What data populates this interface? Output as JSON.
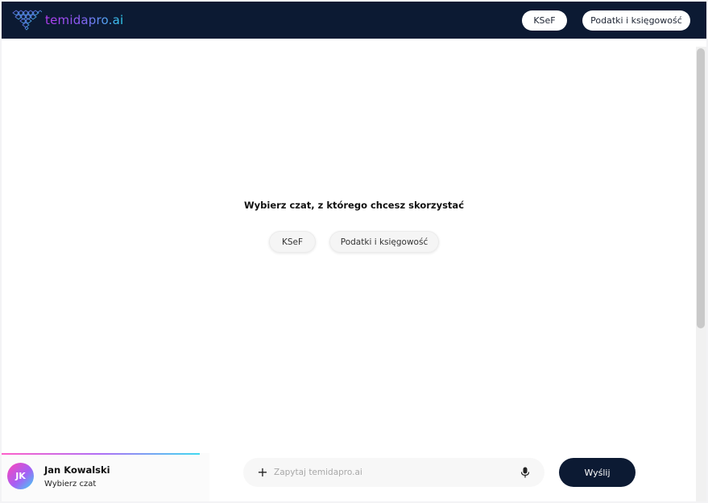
{
  "app": {
    "logo_text": "temidapro.ai"
  },
  "header": {
    "buttons": [
      {
        "label": "KSeF"
      },
      {
        "label": "Podatki i księgowość"
      }
    ]
  },
  "main": {
    "title": "Wybierz czat, z którego chcesz skorzystać",
    "chips": [
      {
        "label": "KSeF"
      },
      {
        "label": "Podatki i księgowość"
      }
    ]
  },
  "user": {
    "initials": "JK",
    "name": "Jan Kowalski",
    "subtitle": "Wybierz czat"
  },
  "composer": {
    "plus_icon": "plus-icon",
    "placeholder": "Zapytaj temidapro.ai",
    "value": "",
    "mic_icon": "microphone-icon",
    "send_label": "Wyślij"
  },
  "colors": {
    "header_bg": "#0c1a33",
    "send_bg": "#0c1a33",
    "accent_pink": "#ff43b8",
    "accent_cyan": "#3ad5f3"
  }
}
